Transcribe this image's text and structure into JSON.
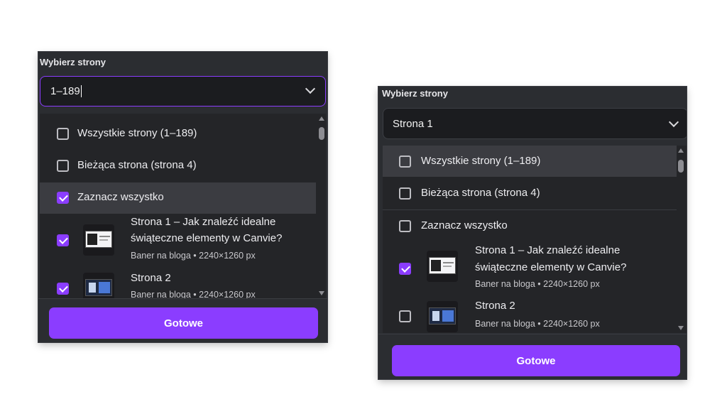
{
  "left_panel": {
    "title": "Wybierz strony",
    "select_value": "1–189",
    "options": [
      {
        "label": "Wszystkie strony (1–189)",
        "checked": false
      },
      {
        "label": "Bieżąca strona (strona 4)",
        "checked": false
      },
      {
        "label": "Zaznacz wszystko",
        "checked": true
      }
    ],
    "pages": [
      {
        "title_line1": "Strona 1 – Jak znaleźć idealne",
        "title_line2": "świąteczne elementy w Canvie?",
        "meta": "Baner na bloga • 2240×1260 px",
        "checked": true
      },
      {
        "title_line1": "Strona 2",
        "meta": "Baner na bloga • 2240×1260 px",
        "checked": true
      }
    ],
    "done_label": "Gotowe"
  },
  "right_panel": {
    "title": "Wybierz strony",
    "select_value": "Strona 1",
    "options": [
      {
        "label": "Wszystkie strony (1–189)",
        "checked": false
      },
      {
        "label": "Bieżąca strona (strona 4)",
        "checked": false
      },
      {
        "label": "Zaznacz wszystko",
        "checked": false
      }
    ],
    "pages": [
      {
        "title_line1": "Strona 1 – Jak znaleźć idealne",
        "title_line2": "świąteczne elementy w Canvie?",
        "meta": "Baner na bloga • 2240×1260 px",
        "checked": true
      },
      {
        "title_line1": "Strona 2",
        "meta": "Baner na bloga • 2240×1260 px",
        "checked": false
      }
    ],
    "done_label": "Gotowe"
  },
  "colors": {
    "accent": "#8b3dff",
    "panel_bg": "#2b2d31",
    "list_bg": "#242528"
  }
}
